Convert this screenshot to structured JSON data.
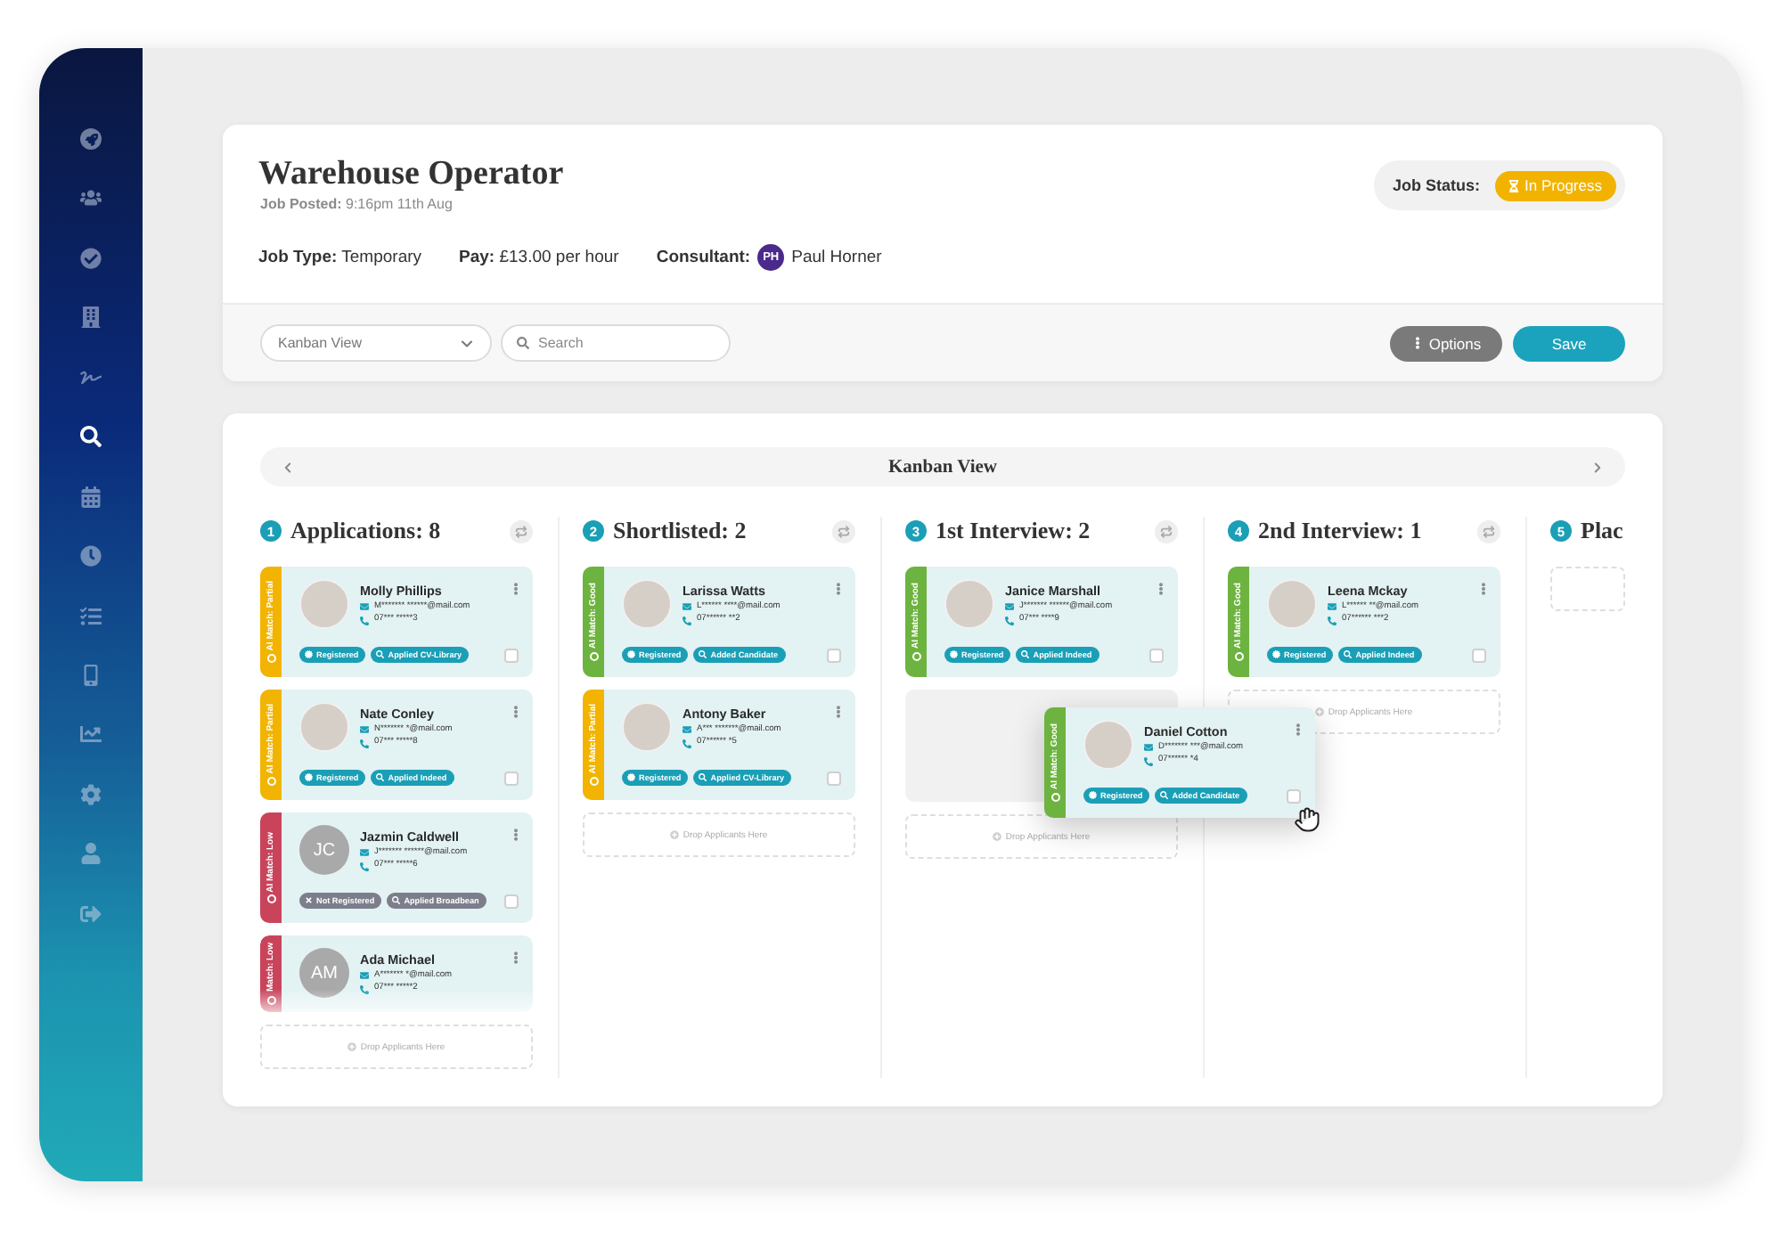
{
  "sidebar": {
    "items": [
      {
        "selected": false
      },
      {
        "selected": false
      },
      {
        "selected": false
      },
      {
        "selected": false
      },
      {
        "selected": false
      },
      {
        "selected": true
      },
      {
        "selected": false
      },
      {
        "selected": false
      },
      {
        "selected": false
      },
      {
        "selected": false
      },
      {
        "selected": false
      },
      {
        "selected": false
      },
      {
        "selected": false
      },
      {
        "selected": false
      }
    ]
  },
  "job": {
    "title": "Warehouse Operator",
    "posted": "**Job Posted:** 9:16pm 11th Aug",
    "details": [
      {
        "kind": "text",
        "text": "**Job Type:** Temporary"
      },
      {
        "kind": "text",
        "text": "**Pay:** £13.00 per hour"
      },
      {
        "kind": "person",
        "label": "Consultant:",
        "initials": "PH",
        "name": "Paul Horner"
      }
    ],
    "status": {
      "label": "Job Status:",
      "value": "In Progress"
    }
  },
  "toolbar": {
    "view_select": "Kanban View",
    "search": {
      "placeholder": "Search"
    },
    "buttons": [
      {
        "kind": "options",
        "label": "Options"
      },
      {
        "kind": "save",
        "label": "Save"
      }
    ]
  },
  "kanban": {
    "title": "Kanban View",
    "columns": [
      {
        "number": "1",
        "title": "Applications: 8",
        "sync": true,
        "faded": true,
        "placeholder": false,
        "drop_hint": "Drop Applicants Here",
        "cards": [
          {
            "match": "AI Match: Partial",
            "color": "#f2b400",
            "avatar": {
              "kind": "photo"
            },
            "name": "Molly Phillips",
            "email": "M******* ******@mail.com",
            "phone": "07*** *****3",
            "tags": [
              {
                "kind": "registered",
                "text": "Registered",
                "color": "#1a9fb6"
              },
              {
                "kind": "source",
                "text": "Applied CV-Library",
                "color": "#1a9fb6"
              }
            ],
            "checked": false
          },
          {
            "match": "AI Match: Partial",
            "color": "#f2b400",
            "avatar": {
              "kind": "photo"
            },
            "name": "Nate Conley",
            "email": "N******* *@mail.com",
            "phone": "07*** *****8",
            "tags": [
              {
                "kind": "registered",
                "text": "Registered",
                "color": "#1a9fb6"
              },
              {
                "kind": "source",
                "text": "Applied Indeed",
                "color": "#1a9fb6"
              }
            ],
            "checked": false
          },
          {
            "match": "AI Match: Low",
            "color": "#c9445b",
            "avatar": {
              "kind": "initials",
              "initials": "JC"
            },
            "name": "Jazmin Caldwell",
            "email": "J******* ******@mail.com",
            "phone": "07*** *****6",
            "tags": [
              {
                "kind": "not_registered",
                "text": "Not Registered",
                "color": "#7c7e8c"
              },
              {
                "kind": "source",
                "text": "Applied Broadbean",
                "color": "#7c7e8c"
              }
            ],
            "checked": false
          },
          {
            "match": "Match: Low",
            "color": "#c9445b",
            "avatar": {
              "kind": "initials",
              "initials": "AM"
            },
            "name": "Ada Michael",
            "email": "A******* *@mail.com",
            "phone": "07*** *****2"
          }
        ]
      },
      {
        "number": "2",
        "title": "Shortlisted: 2",
        "sync": true,
        "faded": false,
        "placeholder": false,
        "drop_hint": "Drop Applicants Here",
        "cards": [
          {
            "match": "AI Match: Good",
            "color": "#6db33f",
            "avatar": {
              "kind": "photo"
            },
            "name": "Larissa Watts",
            "email": "L****** ****@mail.com",
            "phone": "07****** **2",
            "tags": [
              {
                "kind": "registered",
                "text": "Registered",
                "color": "#1a9fb6"
              },
              {
                "kind": "source",
                "text": "Added Candidate",
                "color": "#1a9fb6"
              }
            ],
            "checked": false
          },
          {
            "match": "AI Match: Partial",
            "color": "#f2b400",
            "avatar": {
              "kind": "photo"
            },
            "name": "Antony Baker",
            "email": "A*** *******@mail.com",
            "phone": "07****** *5",
            "tags": [
              {
                "kind": "registered",
                "text": "Registered",
                "color": "#1a9fb6"
              },
              {
                "kind": "source",
                "text": "Applied CV-Library",
                "color": "#1a9fb6"
              }
            ],
            "checked": false
          }
        ]
      },
      {
        "number": "3",
        "title": "1st Interview: 2",
        "sync": true,
        "faded": false,
        "placeholder": true,
        "drop_hint": "Drop Applicants Here",
        "cards": [
          {
            "match": "AI Match: Good",
            "color": "#6db33f",
            "avatar": {
              "kind": "photo"
            },
            "name": "Janice Marshall",
            "email": "J******* ******@mail.com",
            "phone": "07*** ****9",
            "tags": [
              {
                "kind": "registered",
                "text": "Registered",
                "color": "#1a9fb6"
              },
              {
                "kind": "source",
                "text": "Applied Indeed",
                "color": "#1a9fb6"
              }
            ],
            "checked": false
          }
        ]
      },
      {
        "number": "4",
        "title": "2nd Interview: 1",
        "sync": true,
        "faded": false,
        "placeholder": false,
        "drop_hint": "Drop Applicants Here",
        "cards": [
          {
            "match": "AI Match: Good",
            "color": "#6db33f",
            "avatar": {
              "kind": "photo"
            },
            "name": "Leena Mckay",
            "email": "L****** **@mail.com",
            "phone": "07****** ***2",
            "tags": [
              {
                "kind": "registered",
                "text": "Registered",
                "color": "#1a9fb6"
              },
              {
                "kind": "source",
                "text": "Applied Indeed",
                "color": "#1a9fb6"
              }
            ],
            "checked": false
          }
        ]
      },
      {
        "number": "5",
        "title": "Plac",
        "sync": false,
        "placeholder": false
      }
    ],
    "dragged_card": {
      "match": "AI Match: Good",
      "color": "#6db33f",
      "avatar": {
        "kind": "photo"
      },
      "name": "Daniel Cotton",
      "email": "D******* ***@mail.com",
      "phone": "07****** *4",
      "tags": [
        {
          "kind": "registered",
          "text": "Registered",
          "color": "#1a9fb6"
        },
        {
          "kind": "source",
          "text": "Added Candidate",
          "color": "#1a9fb6"
        }
      ],
      "checked": false
    }
  }
}
